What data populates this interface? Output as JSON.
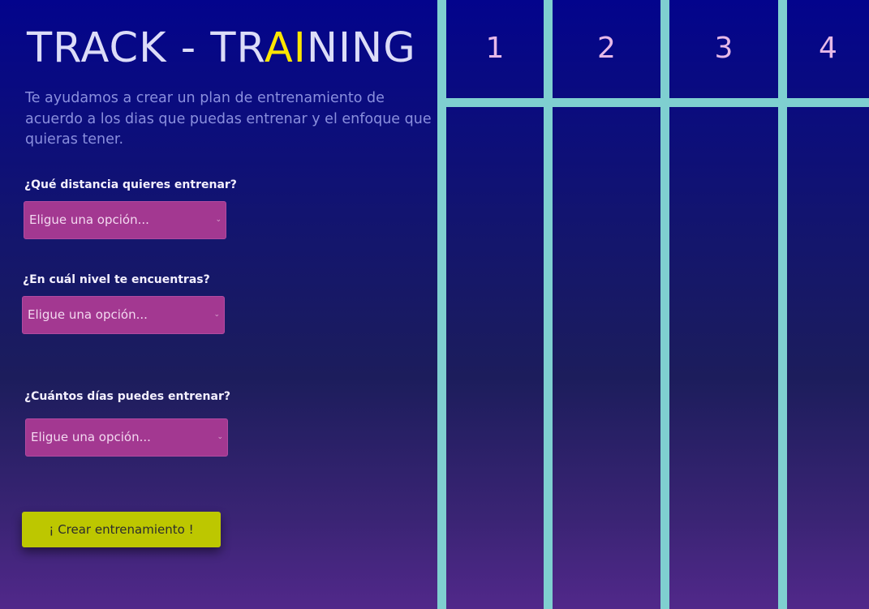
{
  "header": {
    "title_start": "TRACK - TR",
    "title_ai": "AI",
    "title_end": "NING",
    "subtitle": "Te ayudamos a crear un plan de entrenamiento de acuerdo a los dias que puedas entrenar y el enfoque que quieras tener."
  },
  "form": {
    "distance": {
      "label": "¿Qué distancia quieres entrenar?",
      "selected": "Eligue una opción..."
    },
    "level": {
      "label": "¿En cuál nivel te encuentras?",
      "selected": "Eligue una opción..."
    },
    "days": {
      "label": "¿Cuántos días puedes entrenar?",
      "selected": "Eligue una opción..."
    },
    "submit_label": "¡ Crear entrenamiento !"
  },
  "plan": {
    "columns": [
      "1",
      "2",
      "3",
      "4"
    ]
  },
  "colors": {
    "accent_title": "#ffe600",
    "select_bg": "#a33891",
    "button_bg": "#bdc700",
    "grid_lines": "#7fcfd0"
  },
  "icons": {
    "select_arrow": "chevron-down-icon"
  }
}
